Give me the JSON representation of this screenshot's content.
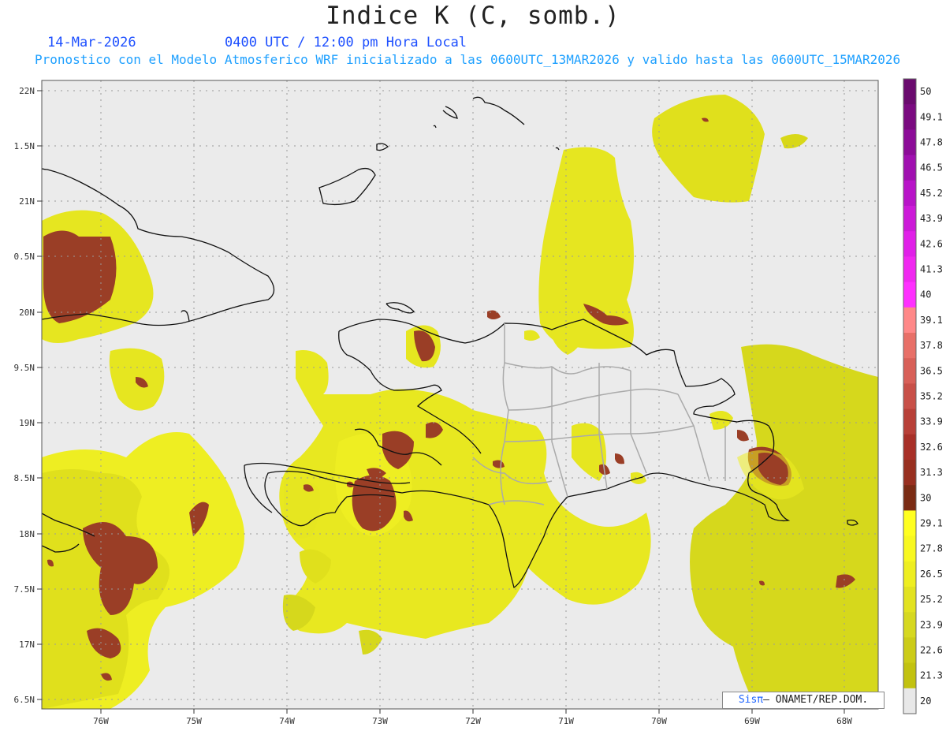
{
  "header": {
    "title": "Indice K (C, somb.)",
    "date": "14-Mar-2026",
    "time": "0400 UTC / 12:00 pm Hora Local",
    "description": "Pronostico con el Modelo Atmosferico WRF inicializado a las 0600UTC_13MAR2026 y valido hasta las  0600UTC_15MAR2026"
  },
  "map": {
    "lat_labels": [
      "22N",
      "1.5N",
      "21N",
      "0.5N",
      "20N",
      "9.5N",
      "19N",
      "8.5N",
      "18N",
      "7.5N",
      "17N",
      "6.5N"
    ],
    "lon_labels": [
      "76W",
      "75W",
      "74W",
      "73W",
      "72W",
      "71W",
      "70W",
      "69W",
      "68W"
    ],
    "background_color": "#ebebeb"
  },
  "colorbar": {
    "labels": [
      "50",
      "49.1",
      "47.8",
      "46.5",
      "45.2",
      "43.9",
      "42.6",
      "41.3",
      "40",
      "39.1",
      "37.8",
      "36.5",
      "35.2",
      "33.9",
      "32.6",
      "31.3",
      "30",
      "29.1",
      "27.8",
      "26.5",
      "25.2",
      "23.9",
      "22.6",
      "21.3",
      "20"
    ],
    "colors": [
      "#6a0a6e",
      "#7a0a80",
      "#8c0c98",
      "#a010b0",
      "#b814c8",
      "#cc1ad8",
      "#e020e8",
      "#f028f0",
      "#ff30ff",
      "#ff8888",
      "#e87068",
      "#d86058",
      "#c85048",
      "#b84038",
      "#a83028",
      "#983020",
      "#7a2c14",
      "#ffff20",
      "#f8f820",
      "#eeee20",
      "#e2e220",
      "#d6d820",
      "#cccc18",
      "#c2c210",
      "#e8e8e8"
    ]
  },
  "credit": {
    "brand": "Sisπ",
    "text": "– ONAMET/REP.DOM."
  }
}
